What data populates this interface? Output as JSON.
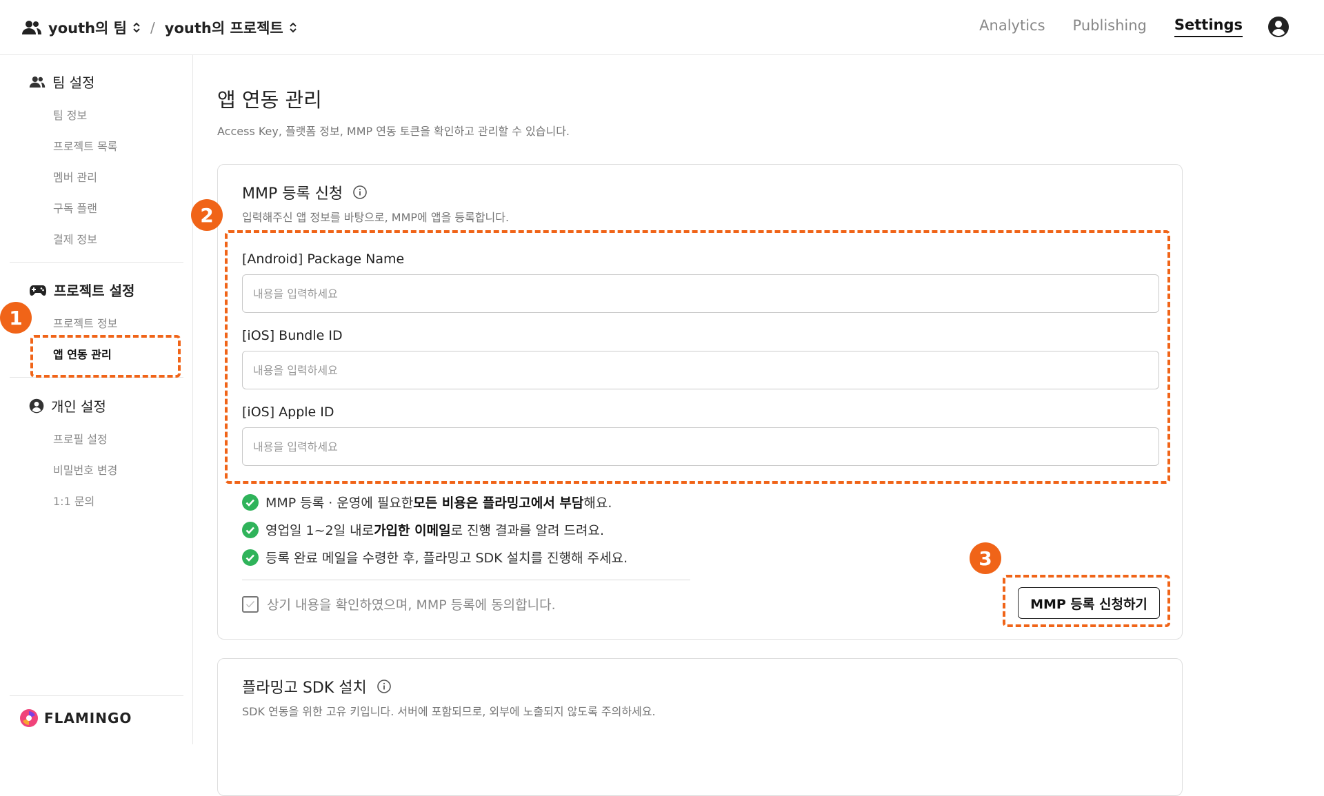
{
  "header": {
    "team": "youth의 팀",
    "separator": "/",
    "project": "youth의 프로젝트",
    "nav": [
      "Analytics",
      "Publishing",
      "Settings"
    ],
    "active_nav": "Settings"
  },
  "sidebar": {
    "team_settings": {
      "title": "팀 설정",
      "items": [
        "팀 정보",
        "프로젝트 목록",
        "멤버 관리",
        "구독 플랜",
        "결제 정보"
      ]
    },
    "project_settings": {
      "title": "프로젝트 설정",
      "items": [
        "프로젝트 정보",
        "앱 연동 관리"
      ],
      "active": "앱 연동 관리"
    },
    "personal_settings": {
      "title": "개인 설정",
      "items": [
        "프로필 설정",
        "비밀번호 변경",
        "1:1 문의"
      ]
    },
    "logo": "FLAMINGO"
  },
  "main": {
    "title": "앱 연동 관리",
    "description": "Access Key, 플랫폼 정보, MMP 연동 토큰을 확인하고 관리할 수 있습니다.",
    "mmp_card": {
      "title": "MMP 등록 신청",
      "description": "입력해주신 앱 정보를 바탕으로, MMP에 앱을 등록합니다.",
      "fields": [
        {
          "label": "[Android] Package Name",
          "placeholder": "내용을 입력하세요",
          "value": ""
        },
        {
          "label": "[iOS] Bundle ID",
          "placeholder": "내용을 입력하세요",
          "value": ""
        },
        {
          "label": "[iOS] Apple ID",
          "placeholder": "내용을 입력하세요",
          "value": ""
        }
      ],
      "notes": [
        {
          "pre": "MMP 등록 · 운영에 필요한 ",
          "bold": "모든 비용은 플라밍고에서 부담",
          "post": "해요."
        },
        {
          "pre": "영업일 1~2일 내로 ",
          "bold": "가입한 이메일",
          "post": "로 진행 결과를 알려 드려요."
        },
        {
          "pre": "등록 완료 메일을 수령한 후, 플라밍고 SDK 설치를 진행해 주세요.",
          "bold": "",
          "post": ""
        }
      ],
      "agreement": "상기 내용을 확인하였으며, MMP 등록에 동의합니다.",
      "agreement_checked": false,
      "submit_label": "MMP 등록 신청하기"
    },
    "sdk_card": {
      "title": "플라밍고 SDK 설치",
      "description": "SDK 연동을 위한 고유 키입니다. 서버에 포함되므로, 외부에 노출되지 않도록 주의하세요."
    }
  },
  "annotations": {
    "markers": [
      "1",
      "2",
      "3"
    ],
    "color": "#f06418"
  },
  "colors": {
    "accent": "#f06418",
    "check_green": "#2fb35a"
  }
}
